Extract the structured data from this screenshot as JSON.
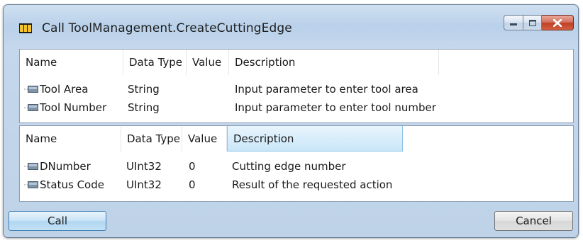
{
  "window": {
    "title": "Call ToolManagement.CreateCuttingEdge",
    "icon": "app-logo-icon"
  },
  "caption_buttons": [
    {
      "name": "minimize",
      "icon": "minimize-icon"
    },
    {
      "name": "maximize",
      "icon": "maximize-icon"
    },
    {
      "name": "close",
      "icon": "close-icon"
    }
  ],
  "input_table": {
    "columns": [
      "Name",
      "Data Type",
      "Value",
      "Description"
    ],
    "rows": [
      {
        "name": "Tool Area",
        "type": "String",
        "value": "",
        "description": "Input parameter to enter tool area"
      },
      {
        "name": "Tool Number",
        "type": "String",
        "value": "",
        "description": "Input parameter to enter tool number"
      }
    ]
  },
  "output_table": {
    "columns": [
      "Name",
      "Data Type",
      "Value",
      "Description"
    ],
    "rows": [
      {
        "name": "DNumber",
        "type": "UInt32",
        "value": "0",
        "description": "Cutting edge number"
      },
      {
        "name": "Status Code",
        "type": "UInt32",
        "value": "0",
        "description": "Result of the requested action"
      }
    ]
  },
  "buttons": {
    "call": "Call",
    "cancel": "Cancel"
  },
  "colors": {
    "window_frame": "#b9d1ea",
    "active_header": "#c9e6f8",
    "close_button": "#c23f25"
  }
}
